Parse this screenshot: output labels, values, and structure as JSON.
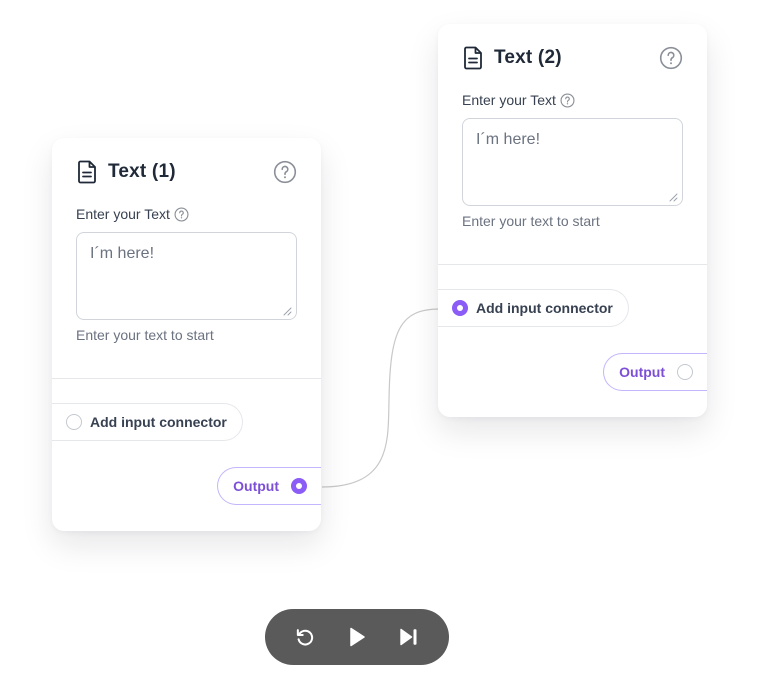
{
  "nodes": [
    {
      "title": "Text (1)",
      "field_label": "Enter your Text",
      "text_value": "I´m here!",
      "helper_text": "Enter your text to start",
      "input_connector_label": "Add input connector",
      "input_connector_connected": false,
      "output_label": "Output",
      "output_connected": true
    },
    {
      "title": "Text (2)",
      "field_label": "Enter your Text",
      "text_value": "I´m here!",
      "helper_text": "Enter your text to start",
      "input_connector_label": "Add input connector",
      "input_connector_connected": true,
      "output_label": "Output",
      "output_connected": false
    }
  ],
  "connection": {
    "from": "Text (1)",
    "to": "Text (2)"
  },
  "toolbar": {
    "buttons": [
      "reset-icon",
      "play-icon",
      "skip-forward-icon"
    ]
  },
  "colors": {
    "accent": "#8b5cf6",
    "output_text": "#7c4fd6",
    "toolbar_bg": "#5a5a5a",
    "wire": "#c8c8c8"
  }
}
